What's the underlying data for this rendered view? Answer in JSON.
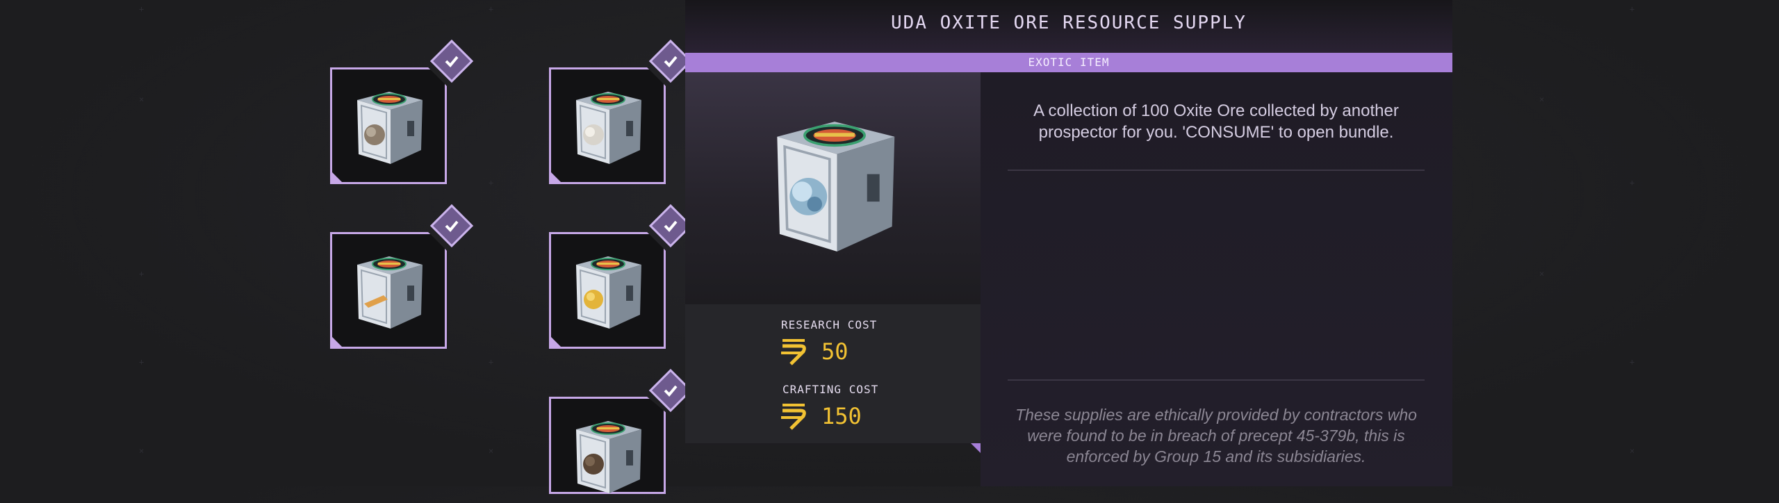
{
  "item": {
    "title": "UDA OXITE ORE RESOURCE SUPPLY",
    "rarity": "EXOTIC ITEM",
    "description": "A collection of 100 Oxite Ore collected by another prospector for you. 'CONSUME' to open bundle.",
    "flavor_text": "These supplies are ethically provided by contractors who were found to be in breach of precept 45-379b, this is enforced by Group 15 and its subsidiaries.",
    "preview_icon": "crate-oxite-ore-icon"
  },
  "costs": {
    "research_label": "RESEARCH COST",
    "research_value": "50",
    "crafting_label": "CRAFTING COST",
    "crafting_value": "150",
    "currency_icon": "credits-icon"
  },
  "inventory": [
    {
      "name": "crate-ore-gray",
      "ore_color": "#8c7d6c",
      "checked": true
    },
    {
      "name": "crate-ore-white",
      "ore_color": "#d8d4cc",
      "checked": true
    },
    {
      "name": "crate-ingot-orange",
      "ore_color": "#e0a04a",
      "checked": true
    },
    {
      "name": "crate-ore-gold",
      "ore_color": "#e3b43a",
      "checked": true
    },
    {
      "name": "crate-ore-brown",
      "ore_color": "#5a4636",
      "checked": true
    }
  ],
  "colors": {
    "accent": "#a77fd8",
    "card_border": "#c7a8e8",
    "cost_value": "#f2c233"
  }
}
